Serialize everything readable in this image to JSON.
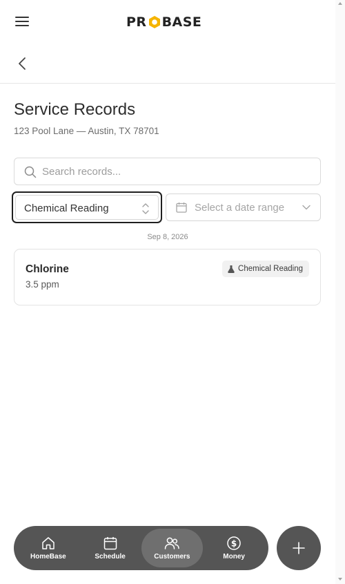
{
  "brand": {
    "logo_left": "PR",
    "logo_right": "BASE",
    "accent_color": "#f5b400"
  },
  "header": {
    "menu_icon": "hamburger-menu-icon",
    "back_icon": "chevron-left-icon"
  },
  "page": {
    "title": "Service Records",
    "subtitle": "123 Pool Lane — Austin, TX 78701"
  },
  "search": {
    "placeholder": "Search records...",
    "value": "",
    "icon": "search-icon"
  },
  "filters": {
    "record_type": "Chemical Reading",
    "date_range_placeholder": "Select a date range"
  },
  "records": {
    "groups": [
      {
        "date": "Sep 8, 2026",
        "items": [
          {
            "name": "Chlorine",
            "value": "3.5 ppm",
            "badge": "Chemical Reading",
            "badge_icon": "flask-icon"
          }
        ]
      }
    ]
  },
  "bottom_nav": {
    "items": [
      {
        "label": "HomeBase",
        "icon": "home-icon",
        "active": false
      },
      {
        "label": "Schedule",
        "icon": "calendar-icon",
        "active": false
      },
      {
        "label": "Customers",
        "icon": "users-icon",
        "active": true
      },
      {
        "label": "Money",
        "icon": "dollar-icon",
        "active": false
      }
    ],
    "fab_icon": "plus-icon"
  }
}
